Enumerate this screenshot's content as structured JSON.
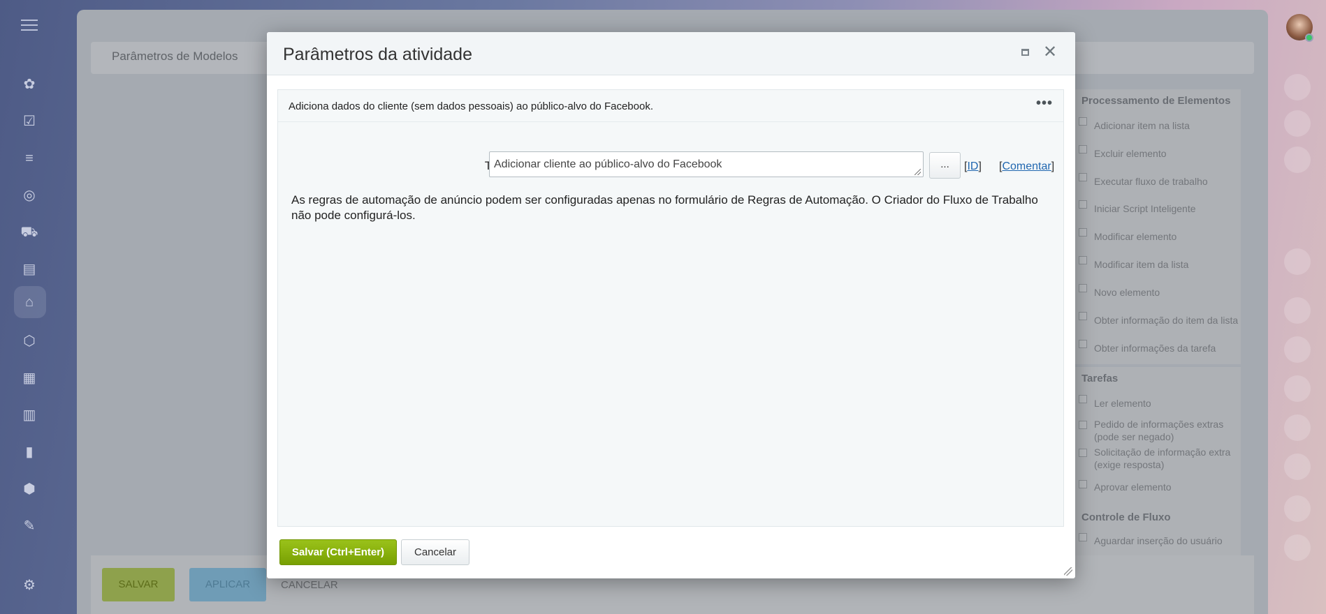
{
  "background": {
    "breadcrumb": "Parâmetros de Modelos",
    "bottom_buttons": {
      "save": "SALVAR",
      "apply": "APLICAR",
      "cancel": "CANCELAR"
    },
    "palette": {
      "groups": [
        {
          "title": "Processamento de Elementos",
          "items": [
            "Adicionar item na lista",
            "Excluir elemento",
            "Executar fluxo de trabalho",
            "Iniciar Script Inteligente",
            "Modificar elemento",
            "Modificar item da lista",
            "Novo elemento",
            "Obter informação do item da lista",
            "Obter informações da tarefa"
          ]
        },
        {
          "title": "Tarefas",
          "items": [
            "Ler elemento",
            "Pedido de informações extras (pode ser negado)",
            "Solicitação de informação extra (exige resposta)",
            "Aprovar elemento"
          ]
        },
        {
          "title": "Controle de Fluxo",
          "items": [
            "Aguardar inserção do usuário"
          ]
        }
      ]
    }
  },
  "dialog": {
    "title": "Parâmetros da atividade",
    "description": "Adiciona dados do cliente (sem dados pessoais) ao público-alvo do Facebook.",
    "more_label": "•••",
    "field_label": "Título:",
    "field_value": "Adicionar cliente ao público-alvo do Facebook",
    "dots_button": "...",
    "id_link": "ID",
    "comment_link": "Comentar",
    "info_text": "As regras de automação de anúncio podem ser configuradas apenas no formulário de Regras de Automação. O Criador do Fluxo de Trabalho não pode configurá-los.",
    "save_button": "Salvar (Ctrl+Enter)",
    "cancel_button": "Cancelar"
  },
  "icons": [
    "menu-icon",
    "close-icon",
    "maximize-icon",
    "more-icon",
    "resize-grip-icon"
  ]
}
